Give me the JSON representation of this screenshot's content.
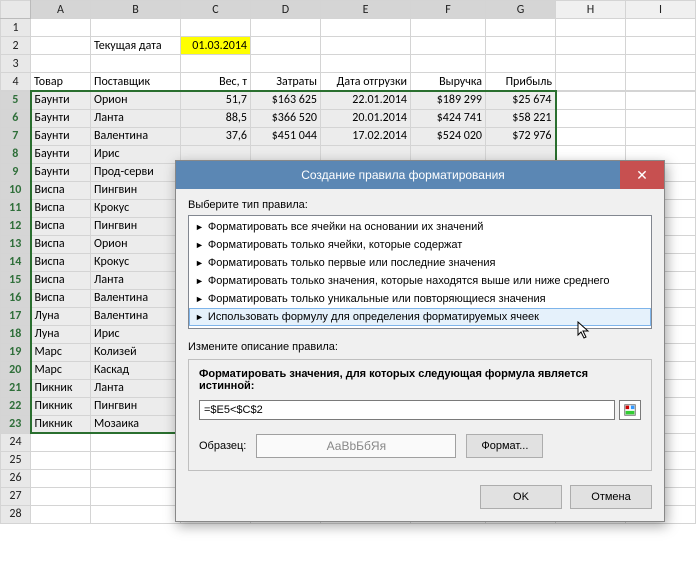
{
  "sheet": {
    "columns": [
      "A",
      "B",
      "C",
      "D",
      "E",
      "F",
      "G",
      "H",
      "I"
    ],
    "current_date_label": "Текущая дата",
    "current_date_value": "01.03.2014",
    "headers": {
      "A": "Товар",
      "B": "Поставщик",
      "C": "Вес, т",
      "D": "Затраты",
      "E": "Дата отгрузки",
      "F": "Выручка",
      "G": "Прибыль"
    },
    "rows": [
      {
        "n": 5,
        "A": "Баунти",
        "B": "Орион",
        "C": "51,7",
        "D": "$163 625",
        "E": "22.01.2014",
        "F": "$189 299",
        "G": "$25 674"
      },
      {
        "n": 6,
        "A": "Баунти",
        "B": "Ланта",
        "C": "88,5",
        "D": "$366 520",
        "E": "20.01.2014",
        "F": "$424 741",
        "G": "$58 221"
      },
      {
        "n": 7,
        "A": "Баунти",
        "B": "Валентина",
        "C": "37,6",
        "D": "$451 044",
        "E": "17.02.2014",
        "F": "$524 020",
        "G": "$72 976"
      },
      {
        "n": 8,
        "A": "Баунти",
        "B": "Ирис"
      },
      {
        "n": 9,
        "A": "Баунти",
        "B": "Прод-серви"
      },
      {
        "n": 10,
        "A": "Виспа",
        "B": "Пингвин"
      },
      {
        "n": 11,
        "A": "Виспа",
        "B": "Крокус"
      },
      {
        "n": 12,
        "A": "Виспа",
        "B": "Пингвин"
      },
      {
        "n": 13,
        "A": "Виспа",
        "B": "Орион"
      },
      {
        "n": 14,
        "A": "Виспа",
        "B": "Крокус"
      },
      {
        "n": 15,
        "A": "Виспа",
        "B": "Ланта"
      },
      {
        "n": 16,
        "A": "Виспа",
        "B": "Валентина"
      },
      {
        "n": 17,
        "A": "Луна",
        "B": "Валентина"
      },
      {
        "n": 18,
        "A": "Луна",
        "B": "Ирис"
      },
      {
        "n": 19,
        "A": "Марс",
        "B": "Колизей"
      },
      {
        "n": 20,
        "A": "Марс",
        "B": "Каскад"
      },
      {
        "n": 21,
        "A": "Пикник",
        "B": "Ланта"
      },
      {
        "n": 22,
        "A": "Пикник",
        "B": "Пингвин"
      },
      {
        "n": 23,
        "A": "Пикник",
        "B": "Мозаика"
      }
    ]
  },
  "dialog": {
    "title": "Создание правила форматирования",
    "select_rule_type": "Выберите тип правила:",
    "rules": [
      "Форматировать все ячейки на основании их значений",
      "Форматировать только ячейки, которые содержат",
      "Форматировать только первые или последние значения",
      "Форматировать только значения, которые находятся выше или ниже среднего",
      "Форматировать только уникальные или повторяющиеся значения",
      "Использовать формулу для определения форматируемых ячеек"
    ],
    "selected_rule_index": 5,
    "edit_rule_label": "Измените описание правила:",
    "formula_legend": "Форматировать значения, для которых следующая формула является истинной:",
    "formula_value": "=$E5<$C$2",
    "preview_label": "Образец:",
    "preview_text": "АаВbБбЯя",
    "format_button": "Формат...",
    "ok": "OK",
    "cancel": "Отмена"
  }
}
